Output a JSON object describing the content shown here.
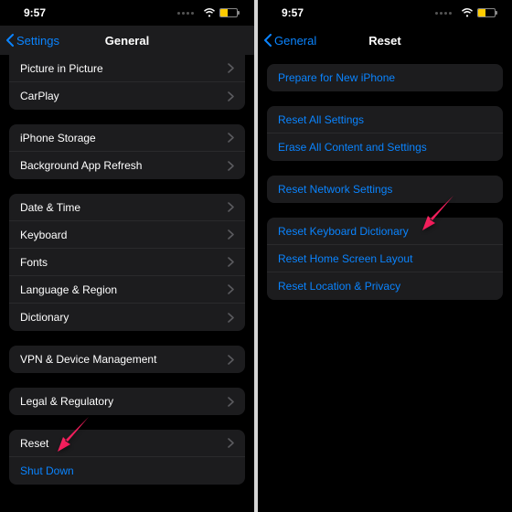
{
  "left": {
    "status": {
      "time": "9:57"
    },
    "nav": {
      "back": "Settings",
      "title": "General"
    },
    "groups": [
      {
        "classes": "group-top-radius-none",
        "rows": [
          {
            "label": "Picture in Picture",
            "chevron": true
          },
          {
            "label": "CarPlay",
            "chevron": true
          }
        ]
      },
      {
        "rows": [
          {
            "label": "iPhone Storage",
            "chevron": true
          },
          {
            "label": "Background App Refresh",
            "chevron": true
          }
        ]
      },
      {
        "rows": [
          {
            "label": "Date & Time",
            "chevron": true
          },
          {
            "label": "Keyboard",
            "chevron": true
          },
          {
            "label": "Fonts",
            "chevron": true
          },
          {
            "label": "Language & Region",
            "chevron": true
          },
          {
            "label": "Dictionary",
            "chevron": true
          }
        ]
      },
      {
        "rows": [
          {
            "label": "VPN & Device Management",
            "chevron": true
          }
        ]
      },
      {
        "rows": [
          {
            "label": "Legal & Regulatory",
            "chevron": true
          }
        ]
      },
      {
        "rows": [
          {
            "label": "Reset",
            "chevron": true
          },
          {
            "label": "Shut Down",
            "chevron": false,
            "link": true
          }
        ]
      }
    ]
  },
  "right": {
    "status": {
      "time": "9:57"
    },
    "nav": {
      "back": "General",
      "title": "Reset"
    },
    "groups": [
      {
        "rows": [
          {
            "label": "Prepare for New iPhone",
            "link": true
          }
        ]
      },
      {
        "rows": [
          {
            "label": "Reset All Settings",
            "link": true
          },
          {
            "label": "Erase All Content and Settings",
            "link": true
          }
        ]
      },
      {
        "rows": [
          {
            "label": "Reset Network Settings",
            "link": true
          }
        ]
      },
      {
        "rows": [
          {
            "label": "Reset Keyboard Dictionary",
            "link": true
          },
          {
            "label": "Reset Home Screen Layout",
            "link": true
          },
          {
            "label": "Reset Location & Privacy",
            "link": true
          }
        ]
      }
    ]
  }
}
